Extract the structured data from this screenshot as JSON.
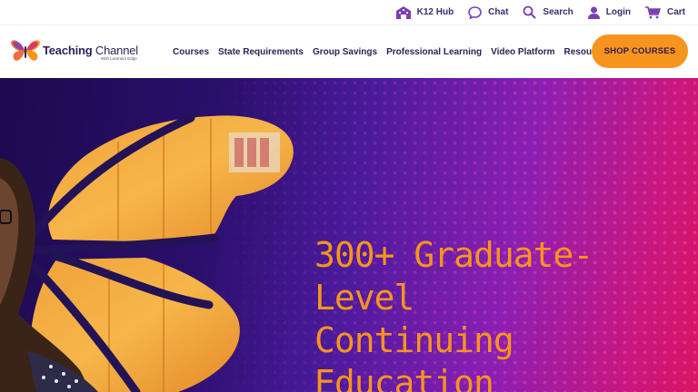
{
  "utility": {
    "k12hub": "K12 Hub",
    "chat": "Chat",
    "search": "Search",
    "login": "Login",
    "cart": "Cart"
  },
  "logo": {
    "name_bold": "Teaching",
    "name_rest": " Channel",
    "sub": "With Learners Edge"
  },
  "nav": {
    "courses": "Courses",
    "state": "State Requirements",
    "group": "Group Savings",
    "professional": "Professional Learning",
    "video": "Video Platform",
    "resources": "Resources"
  },
  "cta": {
    "shop": "SHOP COURSES"
  },
  "hero": {
    "heading_lines": [
      "300+ Graduate-",
      "Level",
      "Continuing",
      "Education"
    ]
  },
  "colors": {
    "brand_navy": "#2b2358",
    "accent_orange": "#f7941d",
    "icon_purple": "#7b3fb5"
  }
}
